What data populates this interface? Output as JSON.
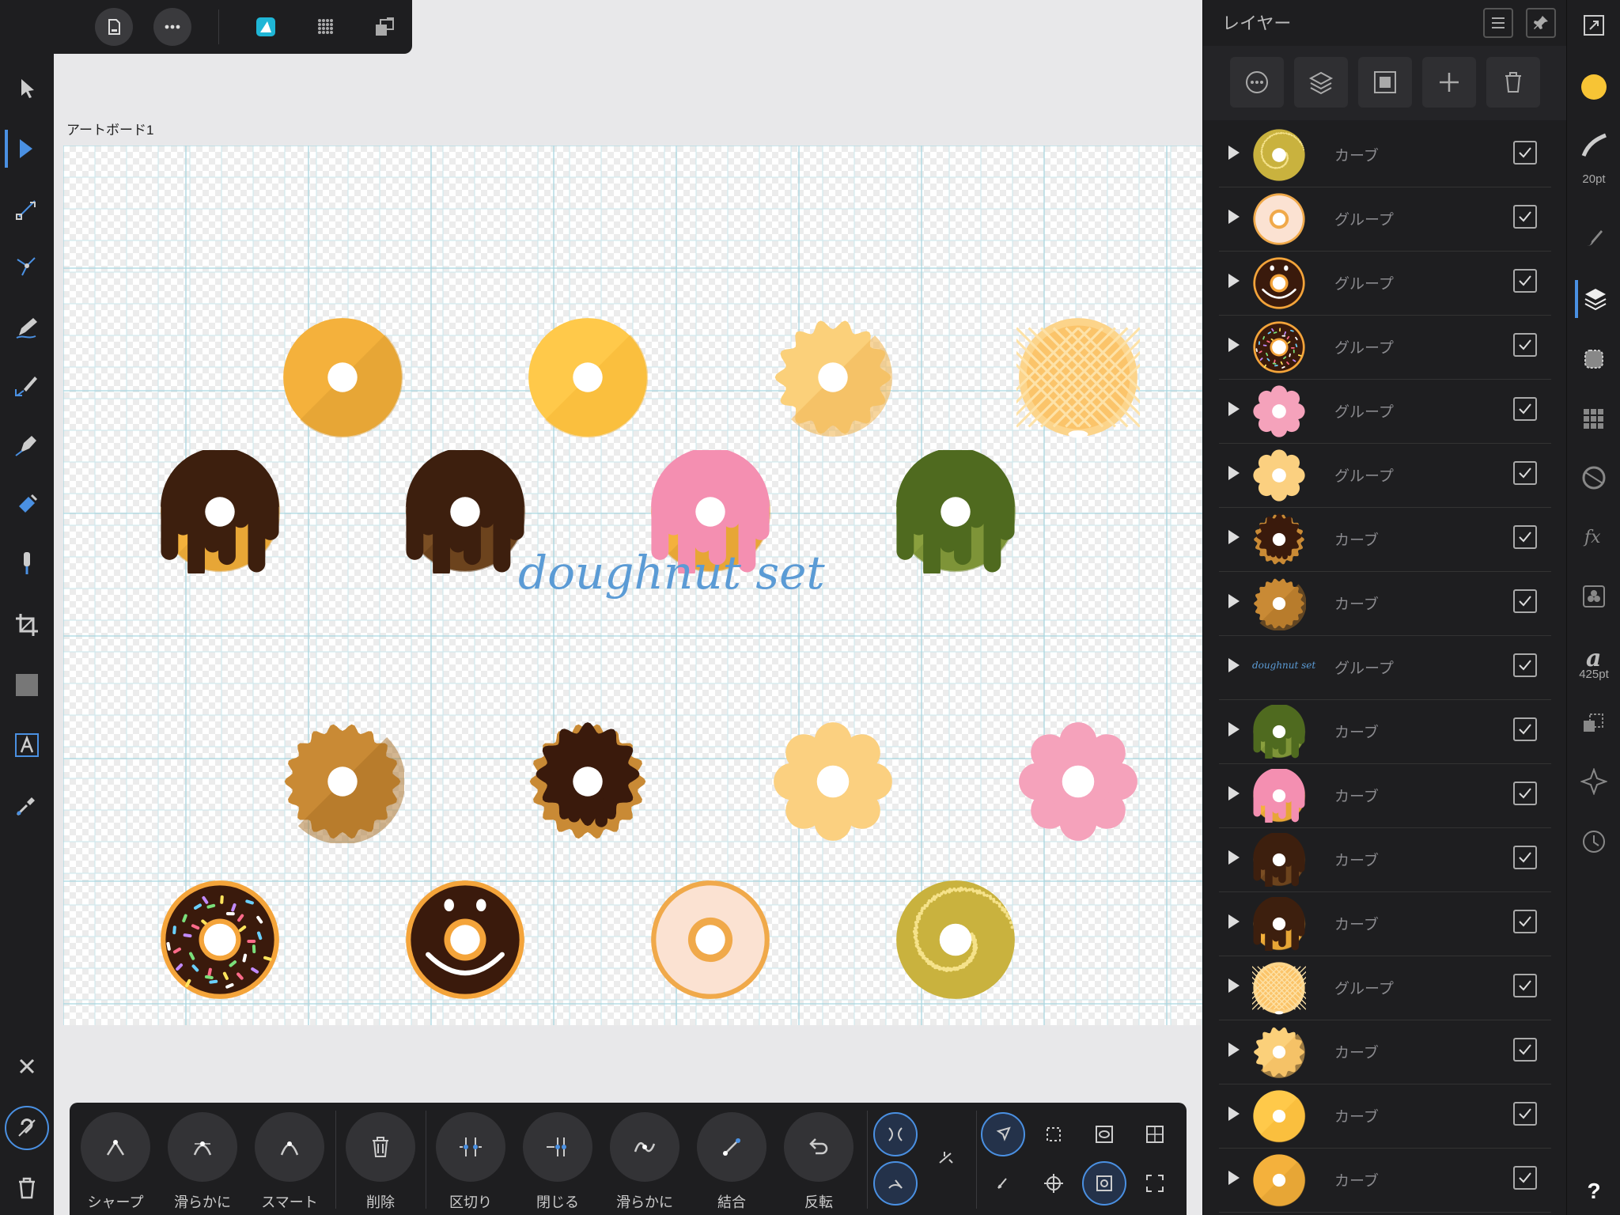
{
  "artboard": {
    "label": "アートボード1",
    "title_text": "doughnut set"
  },
  "toolbar": {
    "back": "back-arrow-icon",
    "document": "document-icon",
    "more": "more-icon",
    "persona": "designer-persona-icon",
    "pixel": "pixel-persona-icon",
    "export": "export-persona-icon"
  },
  "left_tools": [
    "move-tool",
    "node-tool",
    "corner-tool",
    "point-transform-tool",
    "pencil-tool",
    "vector-brush-tool",
    "pen-tool",
    "fill-tool",
    "transparency-tool",
    "crop-tool",
    "rectangle-tool",
    "text-tool",
    "color-picker-tool"
  ],
  "bottom_bar": {
    "buttons": [
      {
        "label": "シャープ",
        "icon": "sharp-node-icon"
      },
      {
        "label": "滑らかに",
        "icon": "smooth-node-icon"
      },
      {
        "label": "スマート",
        "icon": "smart-node-icon"
      },
      {
        "label": "削除",
        "icon": "trash-icon"
      },
      {
        "label": "区切り",
        "icon": "break-curve-icon"
      },
      {
        "label": "閉じる",
        "icon": "close-curve-icon"
      },
      {
        "label": "滑らかに",
        "icon": "smooth-curve-icon"
      },
      {
        "label": "結合",
        "icon": "join-curve-icon"
      },
      {
        "label": "反転",
        "icon": "reverse-curve-icon"
      }
    ]
  },
  "layers": {
    "title": "レイヤー",
    "items": [
      {
        "name": "カーブ",
        "thumb": "gold-glitter",
        "checked": true
      },
      {
        "name": "グループ",
        "thumb": "cream-ring",
        "checked": true
      },
      {
        "name": "グループ",
        "thumb": "smiley",
        "checked": true
      },
      {
        "name": "グループ",
        "thumb": "sprinkle",
        "checked": true
      },
      {
        "name": "グループ",
        "thumb": "pink-pon",
        "checked": true
      },
      {
        "name": "グループ",
        "thumb": "yellow-pon",
        "checked": true
      },
      {
        "name": "カーブ",
        "thumb": "choco-bumpy",
        "checked": true
      },
      {
        "name": "カーブ",
        "thumb": "brown-bumpy",
        "checked": true
      },
      {
        "name": "グループ",
        "thumb": "text",
        "text": "doughnut set",
        "checked": true
      },
      {
        "name": "カーブ",
        "thumb": "matcha-drip",
        "checked": true
      },
      {
        "name": "カーブ",
        "thumb": "pink-drip",
        "checked": true
      },
      {
        "name": "カーブ",
        "thumb": "choco-drip",
        "checked": true
      },
      {
        "name": "カーブ",
        "thumb": "honey-drip",
        "checked": true
      },
      {
        "name": "グループ",
        "thumb": "waffle",
        "checked": true
      },
      {
        "name": "カーブ",
        "thumb": "scallop",
        "checked": true
      },
      {
        "name": "カーブ",
        "thumb": "yellow-plain",
        "checked": true
      },
      {
        "name": "カーブ",
        "thumb": "orange-plain",
        "checked": true
      }
    ]
  },
  "studio": {
    "brush_size": "20pt",
    "font_size": "425pt",
    "fill_color": "#f7c435",
    "help": "?"
  },
  "colors": {
    "accent": "#4a90e2",
    "panel": "#1e1e20",
    "text_blue": "#5b9bd5"
  }
}
